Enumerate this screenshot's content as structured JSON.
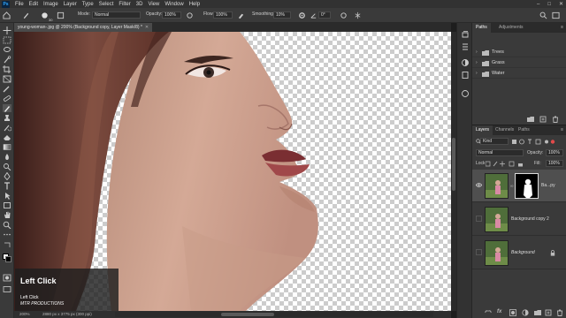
{
  "app": {
    "logo": "Ps"
  },
  "menu": [
    "File",
    "Edit",
    "Image",
    "Layer",
    "Type",
    "Select",
    "Filter",
    "3D",
    "View",
    "Window",
    "Help"
  ],
  "options_bar": {
    "brush_size": "30",
    "mode_label": "Mode:",
    "mode_value": "Normal",
    "opacity_label": "Opacity:",
    "opacity_value": "100%",
    "flow_label": "Flow:",
    "flow_value": "100%",
    "smoothing_label": "Smoothing:",
    "smoothing_value": "10%",
    "angle_value": "0°"
  },
  "document": {
    "tab_title": "young-woman-.jpg @ 200% (Background copy, Layer Mask/8) *",
    "status_zoom": "200%",
    "status_info": "2880 px x 3775 px (300 ppi)"
  },
  "tooltip": {
    "title": "Left Click",
    "line1": "Left Click",
    "line2": "MTR PRODUCTIONS"
  },
  "paths_panel": {
    "tabs": [
      "Paths",
      "Adjustments"
    ],
    "groups": [
      "Trees",
      "Grass",
      "Water"
    ]
  },
  "layers_panel": {
    "tabs": [
      "Layers",
      "Channels",
      "Paths"
    ],
    "kind_value": "Kind",
    "blend_mode": "Normal",
    "opacity_label": "Opacity:",
    "opacity_value": "100%",
    "lock_label": "Lock:",
    "fill_label": "Fill:",
    "fill_value": "100%",
    "layers": [
      {
        "name": "Ba...py",
        "visible": true,
        "selected": true,
        "has_mask": true
      },
      {
        "name": "Background copy 2",
        "visible": false,
        "selected": false,
        "has_mask": false
      },
      {
        "name": "Background",
        "visible": false,
        "selected": false,
        "has_mask": false,
        "locked": true
      }
    ]
  },
  "colors": {
    "foreground": "#ffffff",
    "background": "#000000",
    "accent": "#31a8ff"
  }
}
